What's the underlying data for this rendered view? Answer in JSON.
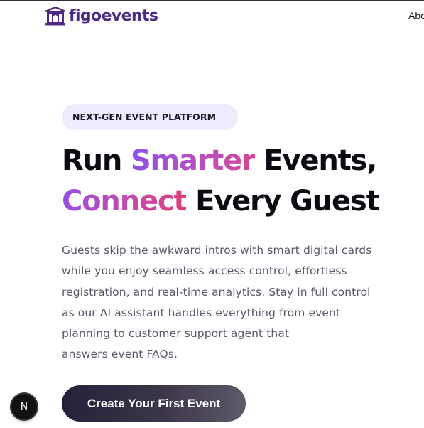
{
  "header": {
    "logo_text": "figoevents",
    "logo_icon": "venue-building-icon",
    "nav_about": "Abo"
  },
  "hero": {
    "badge": "NEXT-GEN EVENT PLATFORM",
    "headline_line1": {
      "part1": "Run ",
      "highlight": "Smarter",
      "part2": " Events,"
    },
    "headline_line2": {
      "highlight": "Connect",
      "part2": " Every Guest"
    },
    "description_lines": [
      "Guests skip the awkward intros with smart digital cards",
      "while you enjoy seamless access control, effortless",
      "registration, and real-time analytics. Stay in full control",
      "as our AI assistant handles everything from event",
      "planning to customer support agent that",
      "answers event FAQs."
    ],
    "cta_label": "Create Your First Event"
  },
  "dev_badge": {
    "label": "N"
  },
  "colors": {
    "brand": "#4a2a84",
    "highlight_start": "#8e52e8",
    "highlight_end": "#d6448f",
    "badge_bg": "#efeafc",
    "cta_bg": "#26203a"
  }
}
